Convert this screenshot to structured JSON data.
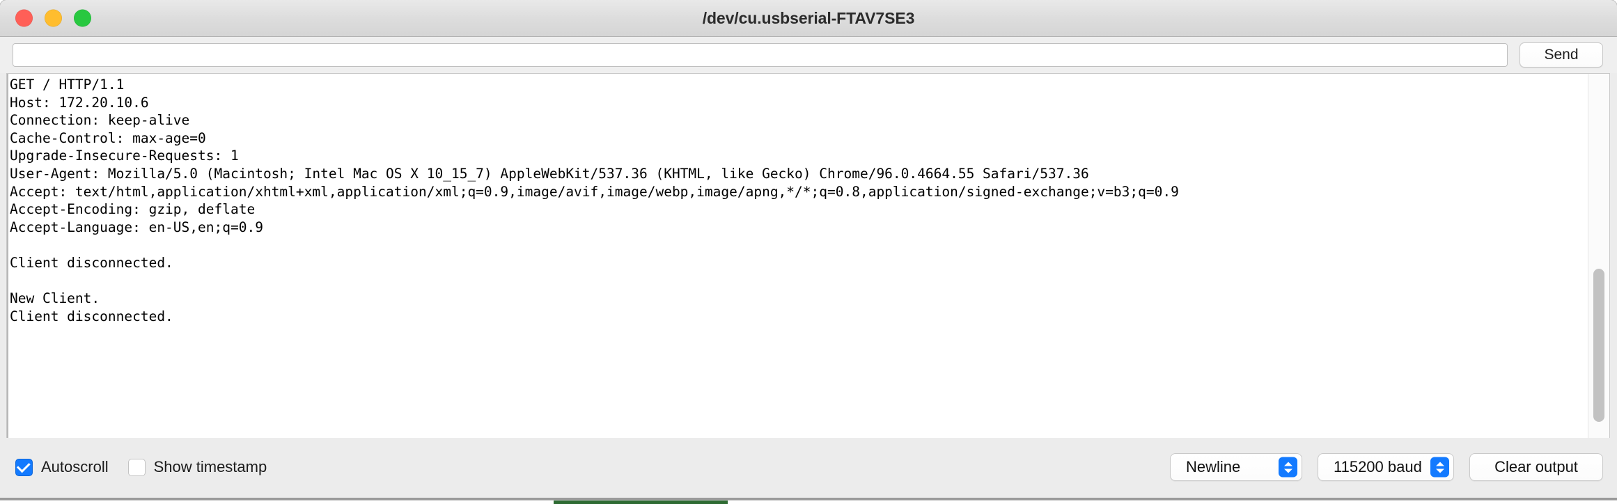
{
  "window": {
    "title": "/dev/cu.usbserial-FTAV7SE3",
    "traffic_lights": {
      "close_label": "close",
      "minimize_label": "minimize",
      "zoom_label": "zoom",
      "close_color": "#ff5f57",
      "minimize_color": "#ffbd2e",
      "zoom_color": "#28c840"
    }
  },
  "toolbar": {
    "input_value": "",
    "input_placeholder": "",
    "send_label": "Send"
  },
  "console": {
    "lines": [
      "GET / HTTP/1.1",
      "Host: 172.20.10.6",
      "Connection: keep-alive",
      "Cache-Control: max-age=0",
      "Upgrade-Insecure-Requests: 1",
      "User-Agent: Mozilla/5.0 (Macintosh; Intel Mac OS X 10_15_7) AppleWebKit/537.36 (KHTML, like Gecko) Chrome/96.0.4664.55 Safari/537.36",
      "Accept: text/html,application/xhtml+xml,application/xml;q=0.9,image/avif,image/webp,image/apng,*/*;q=0.8,application/signed-exchange;v=b3;q=0.9",
      "Accept-Encoding: gzip, deflate",
      "Accept-Language: en-US,en;q=0.9",
      "",
      "Client disconnected.",
      "",
      "New Client.",
      "Client disconnected."
    ],
    "text": "GET / HTTP/1.1\nHost: 172.20.10.6\nConnection: keep-alive\nCache-Control: max-age=0\nUpgrade-Insecure-Requests: 1\nUser-Agent: Mozilla/5.0 (Macintosh; Intel Mac OS X 10_15_7) AppleWebKit/537.36 (KHTML, like Gecko) Chrome/96.0.4664.55 Safari/537.36\nAccept: text/html,application/xhtml+xml,application/xml;q=0.9,image/avif,image/webp,image/apng,*/*;q=0.8,application/signed-exchange;v=b3;q=0.9\nAccept-Encoding: gzip, deflate\nAccept-Language: en-US,en;q=0.9\n\nClient disconnected.\n\nNew Client.\nClient disconnected."
  },
  "footer": {
    "autoscroll": {
      "label": "Autoscroll",
      "checked": true
    },
    "show_timestamp": {
      "label": "Show timestamp",
      "checked": false
    },
    "line_ending": {
      "selected": "Newline"
    },
    "baud_rate": {
      "selected": "115200 baud"
    },
    "clear_output_label": "Clear output"
  },
  "colors": {
    "accent": "#137aff",
    "window_chrome": "#ececec",
    "console_background": "#ffffff",
    "console_text": "#000000"
  }
}
